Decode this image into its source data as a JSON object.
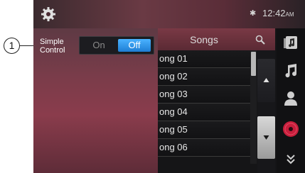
{
  "callout": {
    "number": "1"
  },
  "status_bar": {
    "bluetooth_glyph": "✱",
    "time": "12:42",
    "ampm": "AM"
  },
  "simple_control": {
    "label_line1": "Simple",
    "label_line2": "Control",
    "on_label": "On",
    "off_label": "Off",
    "selected": "Off"
  },
  "songs": {
    "title": "Songs",
    "items": [
      "ong 01",
      "ong 02",
      "ong 03",
      "ong 04",
      "ong 05",
      "ong 06"
    ]
  },
  "colors": {
    "accent": "#2f97ef",
    "panel": "#7b3c4a",
    "background": "#151517"
  },
  "icons": [
    "gear-icon",
    "bluetooth-icon",
    "search-icon",
    "music-library-icon",
    "music-note-icon",
    "person-icon",
    "disc-icon",
    "double-chevron-down-icon"
  ]
}
